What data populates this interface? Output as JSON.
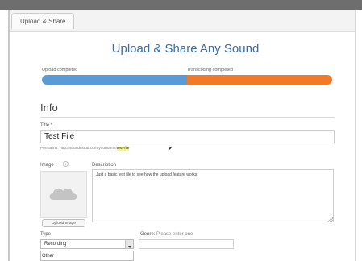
{
  "tab": {
    "label": "Upload & Share"
  },
  "page": {
    "title": "Upload & Share Any Sound"
  },
  "progress": {
    "upload_label": "Upload completed",
    "transcode_label": "Transcoding completed",
    "upload_fraction": 0.5,
    "transcode_fraction": 0.5,
    "colors": {
      "upload": "#5b9bd5",
      "transcode": "#f07a27"
    }
  },
  "info": {
    "heading": "Info",
    "title_label": "Title *",
    "title_value": "Test File",
    "permalink_prefix": "Permalink: http://soundcloud.com/yourname/",
    "permalink_slug": "test-file",
    "image_label": "Image",
    "upload_image_label": "Upload Image",
    "description_label": "Description",
    "description_value": "Just a basic test file to see how the upload feature works",
    "type_label": "Type",
    "type_value": "Recording",
    "type_option_visible": "Other",
    "genre_label": "Genre",
    "genre_hint": "Please enter one"
  },
  "icons": [
    "pencil-icon",
    "info-icon",
    "cloud-icon",
    "select-arrow-icon",
    "resize-handle-icon"
  ]
}
